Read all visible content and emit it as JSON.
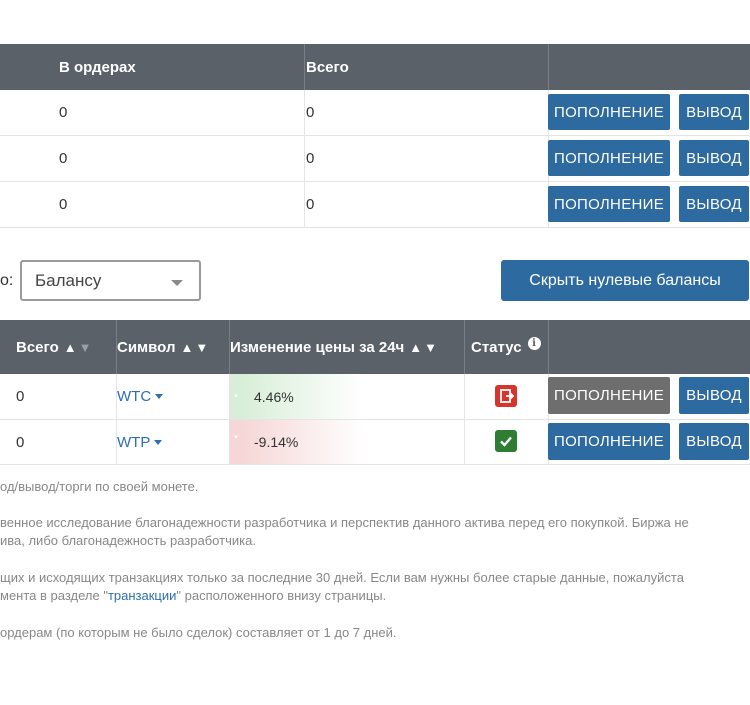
{
  "top_table": {
    "headers": {
      "in_orders": "В ордерах",
      "total": "Всего"
    },
    "rows": [
      {
        "in_orders": "0",
        "total": "0"
      },
      {
        "in_orders": "0",
        "total": "0"
      },
      {
        "in_orders": "0",
        "total": "0"
      }
    ],
    "deposit_label": "ПОПОЛНЕНИЕ",
    "withdraw_label": "ВЫВОД"
  },
  "controls": {
    "sort_label": "о:",
    "sort_select_value": "Балансу",
    "hide_zero_button": "Скрыть нулевые балансы"
  },
  "bottom_table": {
    "headers": {
      "total": "Всего",
      "symbol": "Символ",
      "change_24h": "Изменение цены за 24ч",
      "status": "Статус"
    },
    "sort_arrows": "▲▼",
    "rows": [
      {
        "total": "0",
        "symbol": "WTC",
        "change": "4.46%",
        "trend": "up",
        "status": "exit",
        "deposit_disabled": true
      },
      {
        "total": "0",
        "symbol": "WTP",
        "change": "-9.14%",
        "trend": "down",
        "status": "ok",
        "deposit_disabled": false
      }
    ],
    "deposit_label": "ПОПОЛНЕНИЕ",
    "withdraw_label": "ВЫВОД"
  },
  "notes": {
    "line1": "од/вывод/торги по своей монете.",
    "line2a": "венное исследование благонадежности разработчика и перспектив данного актива перед его покупкой. Биржа не",
    "line2b": "ива, либо благонадежность разработчика.",
    "line3a": "щих и исходящих транзакциях только за последние 30 дней. Если вам нужны более старые данные, пожалуйста",
    "line3b_pre": "мента в разделе \"",
    "line3b_link": "транзакции",
    "line3b_post": "\" расположенного внизу страницы.",
    "line4": "ордерам (по которым не было сделок) составляет от 1 до 7 дней."
  },
  "colors": {
    "header_bg": "#5b6168",
    "button_blue": "#2d6a9f",
    "button_grey": "#6e6e6e",
    "positive_tint": "#d8eed8",
    "negative_tint": "#f6d6d6",
    "status_exit": "#d9342b",
    "status_ok": "#2e7d32"
  },
  "icons": {
    "status_info": "info-icon",
    "status_exit": "exit-door-icon",
    "status_ok": "checkmark-icon"
  }
}
